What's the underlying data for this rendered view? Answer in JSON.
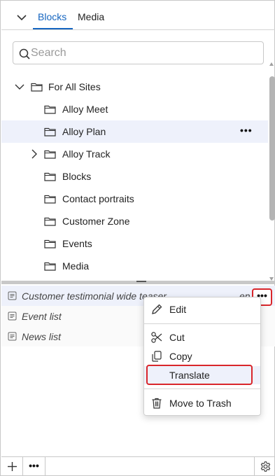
{
  "tabs": {
    "blocks": "Blocks",
    "media": "Media",
    "active": "Blocks"
  },
  "search": {
    "placeholder": "Search",
    "value": ""
  },
  "tree": {
    "root": "For All Sites",
    "items": [
      {
        "label": "Alloy Meet"
      },
      {
        "label": "Alloy Plan",
        "selected": true,
        "more": "•••"
      },
      {
        "label": "Alloy Track",
        "expandable": true
      },
      {
        "label": "Blocks"
      },
      {
        "label": "Contact portraits"
      },
      {
        "label": "Customer Zone"
      },
      {
        "label": "Events"
      },
      {
        "label": "Media"
      }
    ]
  },
  "list": {
    "items": [
      {
        "label": "Customer testimonial wide teaser",
        "lang": "en",
        "more": "•••"
      },
      {
        "label": "Event list"
      },
      {
        "label": "News list"
      }
    ]
  },
  "context_menu": {
    "edit": "Edit",
    "cut": "Cut",
    "copy": "Copy",
    "translate": "Translate",
    "trash": "Move to Trash"
  },
  "footer": {
    "more": "•••"
  },
  "colors": {
    "accent": "#1565c0",
    "highlight_border": "#d9262b",
    "selected_row": "#eef1fb"
  }
}
